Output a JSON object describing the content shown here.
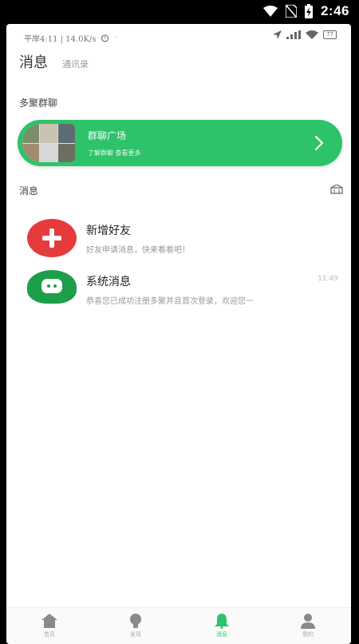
{
  "system_bar": {
    "time": "2:46"
  },
  "inner_status": {
    "left_text": "平岸4:11 | 14.0K/s",
    "battery_label": "77"
  },
  "tabs": [
    {
      "label": "消息",
      "active": true
    },
    {
      "label": "通讯录",
      "active": false
    }
  ],
  "hot_chat": {
    "section_title": "多聚群聊",
    "banner_title": "群聊广场",
    "banner_subtitle": "了解群聊   查看更多"
  },
  "messages_section_title": "消息",
  "messages": [
    {
      "name": "新增好友",
      "preview": "好友申请消息，快来看看吧！",
      "time": "",
      "avatar_color": "#e53b3b",
      "icon": "plus-icon"
    },
    {
      "name": "系统消息",
      "preview": "恭喜您已成功注册多聚并且首次登录，欢迎您一",
      "time": "11:49",
      "avatar_color": "#1e9e4a",
      "icon": "chat-bubble-icon"
    }
  ],
  "bottom_nav": [
    {
      "label": "首页",
      "icon": "home-icon",
      "active": false
    },
    {
      "label": "发现",
      "icon": "bulb-icon",
      "active": false
    },
    {
      "label": "消息",
      "icon": "bell-icon",
      "active": true
    },
    {
      "label": "我的",
      "icon": "user-icon",
      "active": false
    }
  ],
  "colors": {
    "accent": "#2ec26a",
    "add_friend": "#e53b3b",
    "system": "#1e9e4a"
  }
}
